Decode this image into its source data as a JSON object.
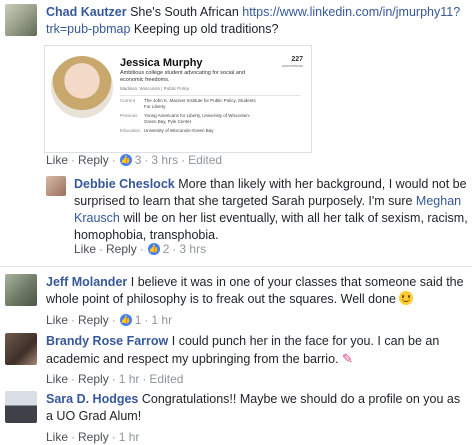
{
  "comments": [
    {
      "author": "Chad Kautzer",
      "text_before": "She's South African ",
      "link": "https://www.linkedin.com/in/jmurphy11?trk=pub-pbmap",
      "text_after": " Keeping up old traditions?",
      "actions": {
        "like": "Like",
        "reply": "Reply",
        "reactions": "3",
        "time": "3 hrs",
        "edited": "Edited"
      },
      "card": {
        "name": "Jessica Murphy",
        "connections": "227",
        "connections_label": "connections",
        "tagline": "Ambitious college student advocating for social and economic freedoms.",
        "location": "Madison, Wisconsin | Public Policy",
        "rows": [
          {
            "label": "Current",
            "value": "The John K. MacIver Institute for Public Policy, Students For Liberty"
          },
          {
            "label": "Previous",
            "value": "Young Americans for Liberty, University of Wisconsin-Green Bay, Pyle Center"
          },
          {
            "label": "Education",
            "value": "University of Wisconsin-Green Bay"
          }
        ]
      }
    },
    {
      "author": "Debbie Cheslock",
      "text_before": "More than likely with her background, I would not be surprised to learn that she targeted Sarah purposely. I'm sure ",
      "mention": "Meghan Krausch",
      "text_after": " will be on her list eventually, with all her talk of sexism, racism, homophobia, transphobia.",
      "actions": {
        "like": "Like",
        "reply": "Reply",
        "reactions": "2",
        "time": "3 hrs"
      }
    },
    {
      "author": "Jeff Molander",
      "text": "I believe it was in one of your classes that someone said the whole point of philosophy is to freak out the squares. Well done",
      "actions": {
        "like": "Like",
        "reply": "Reply",
        "reactions": "1",
        "time": "1 hr"
      }
    },
    {
      "author": "Brandy Rose Farrow",
      "text": "I could punch her in the face for you. I can be an academic and respect my upbringing from the barrio.",
      "actions": {
        "like": "Like",
        "reply": "Reply",
        "time": "1 hr",
        "edited": "Edited"
      }
    },
    {
      "author": "Sara D. Hodges",
      "text": "Congratulations!! Maybe we should do a profile on you as a UO Grad Alum!",
      "actions": {
        "like": "Like",
        "reply": "Reply",
        "time": "1 hr"
      }
    }
  ],
  "icons": {
    "like_badge": "thumbs-up-icon",
    "smile": "smiley-emoji-icon",
    "nails": "nail-polish-emoji-icon"
  },
  "colors": {
    "link": "#365899",
    "like_badge": "#4080ff",
    "meta": "#90949c"
  }
}
